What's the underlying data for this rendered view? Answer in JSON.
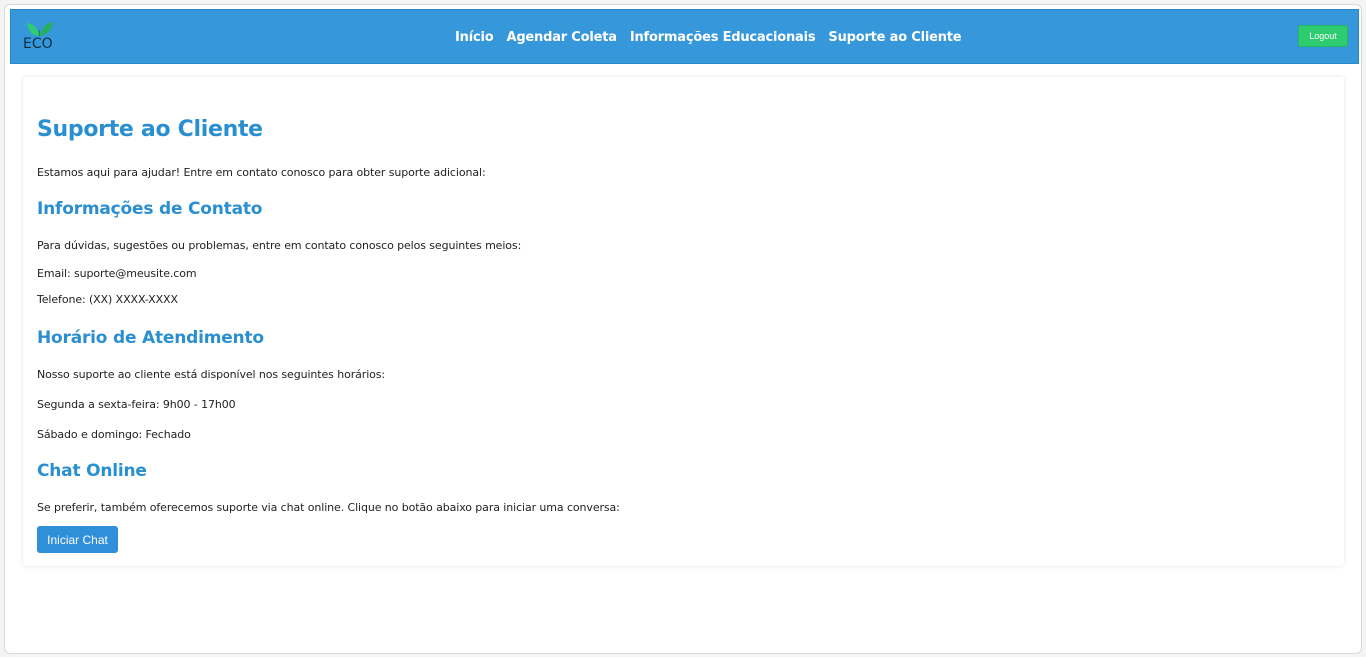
{
  "colors": {
    "navbar": "#3797db",
    "accent": "#2a8fd0",
    "logout": "#2ecc71",
    "button": "#2f8fd8"
  },
  "logo": {
    "text": "ECO",
    "icon": "leaf-icon"
  },
  "nav": {
    "items": [
      {
        "label": "Início"
      },
      {
        "label": "Agendar Coleta"
      },
      {
        "label": "Informações Educacionais"
      },
      {
        "label": "Suporte ao Cliente"
      }
    ],
    "logout_label": "Logout"
  },
  "main": {
    "title": "Suporte ao Cliente",
    "intro": "Estamos aqui para ajudar! Entre em contato conosco para obter suporte adicional:",
    "contact": {
      "title": "Informações de Contato",
      "description": "Para dúvidas, sugestões ou problemas, entre em contato conosco pelos seguintes meios:",
      "email": "Email: suporte@meusite.com",
      "phone": "Telefone: (XX) XXXX-XXXX"
    },
    "hours": {
      "title": "Horário de Atendimento",
      "description": "Nosso suporte ao cliente está disponível nos seguintes horários:",
      "weekdays": "Segunda a sexta-feira: 9h00 - 17h00",
      "weekend": "Sábado e domingo: Fechado"
    },
    "chat": {
      "title": "Chat Online",
      "description": "Se preferir, também oferecemos suporte via chat online. Clique no botão abaixo para iniciar uma conversa:",
      "button_label": "Iniciar Chat"
    }
  }
}
